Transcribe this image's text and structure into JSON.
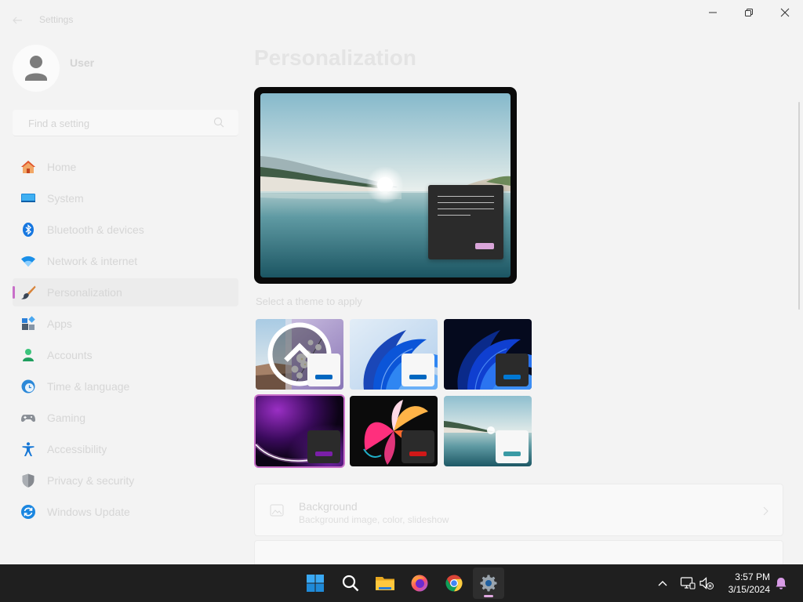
{
  "window": {
    "title": "Settings"
  },
  "account": {
    "name": "User"
  },
  "search": {
    "placeholder": "Find a setting"
  },
  "nav": {
    "selected_index": 4,
    "items": [
      {
        "label": "Home",
        "icon": "home-icon"
      },
      {
        "label": "System",
        "icon": "monitor-icon"
      },
      {
        "label": "Bluetooth & devices",
        "icon": "bluetooth-icon"
      },
      {
        "label": "Network & internet",
        "icon": "wifi-icon"
      },
      {
        "label": "Personalization",
        "icon": "brush-icon"
      },
      {
        "label": "Apps",
        "icon": "apps-icon"
      },
      {
        "label": "Accounts",
        "icon": "person-icon"
      },
      {
        "label": "Time & language",
        "icon": "globe-clock-icon"
      },
      {
        "label": "Gaming",
        "icon": "controller-icon"
      },
      {
        "label": "Accessibility",
        "icon": "accessibility-icon"
      },
      {
        "label": "Privacy & security",
        "icon": "shield-icon"
      },
      {
        "label": "Windows Update",
        "icon": "update-icon"
      }
    ]
  },
  "page": {
    "title": "Personalization"
  },
  "preview": {
    "button_color": "#d9a5d9"
  },
  "themes": {
    "heading": "Select a theme to apply",
    "selected_index": 3,
    "items": [
      {
        "icon": "spotlight-icon",
        "card_color": "#f7f7f7",
        "bar_color": "#0067c0"
      },
      {
        "card_color": "#f7f7f7",
        "bar_color": "#0067c0"
      },
      {
        "card_color": "#2b2b2b",
        "bar_color": "#0078d4"
      },
      {
        "card_color": "#2b2b2b",
        "bar_color": "#7a1fa8"
      },
      {
        "card_color": "#2b2b2b",
        "bar_color": "#d01818"
      },
      {
        "card_color": "#f7f7f7",
        "bar_color": "#3a9aa5"
      }
    ]
  },
  "settings_cards": [
    {
      "title": "Background",
      "subtitle": "Background image, color, slideshow",
      "icon": "image-icon"
    }
  ],
  "taskbar": {
    "apps": [
      "start-icon",
      "search-icon",
      "file-explorer-icon",
      "firefox-icon",
      "chrome-icon",
      "settings-gear-icon"
    ],
    "active_app": "settings-gear-icon",
    "time": "3:57 PM",
    "date": "3/15/2024"
  },
  "colors": {
    "accent": "#0067c0",
    "selection_indicator": "#c86fc9",
    "taskbar_bg": "#1f1f1f"
  }
}
